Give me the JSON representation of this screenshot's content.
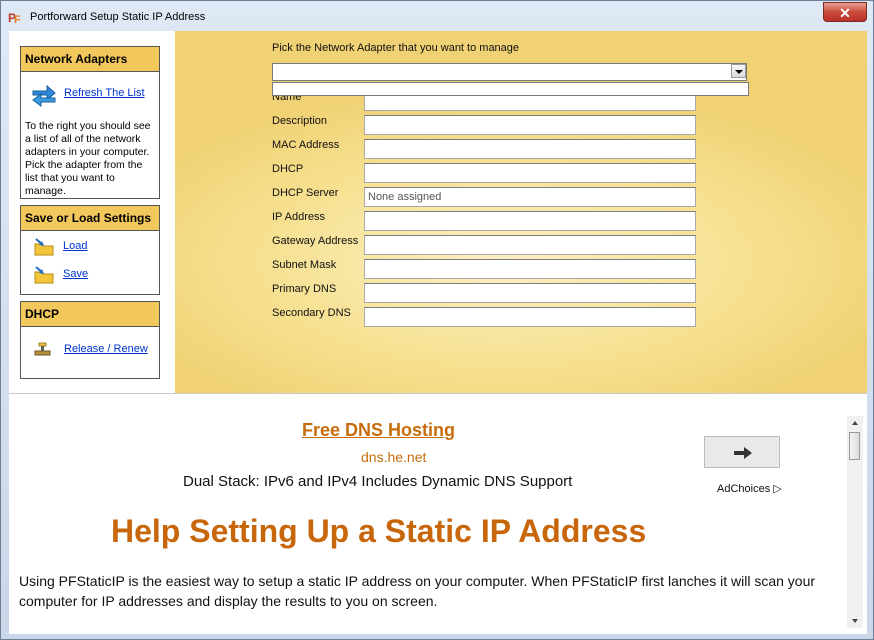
{
  "window": {
    "title": "Portforward Setup Static IP Address",
    "close_label": "✕"
  },
  "sidebar": {
    "network_adapters": {
      "heading": "Network Adapters",
      "refresh_label": "Refresh The List",
      "help_text": "To the right you should see a list of all of the network adapters in your computer. Pick the adapter from the list that you want to manage."
    },
    "save_load": {
      "heading": "Save or Load Settings",
      "load_label": "Load",
      "save_label": "Save"
    },
    "dhcp": {
      "heading": "DHCP",
      "release_label": "Release / Renew"
    }
  },
  "adapter_form": {
    "pick_label": "Pick the Network Adapter that you want to manage",
    "selected_adapter": "",
    "fields": {
      "name": {
        "label": "Name",
        "value": ""
      },
      "description": {
        "label": "Description",
        "value": ""
      },
      "mac": {
        "label": "MAC Address",
        "value": ""
      },
      "dhcp": {
        "label": "DHCP",
        "value": ""
      },
      "dhcp_server": {
        "label": "DHCP Server",
        "value": "None assigned"
      },
      "ip": {
        "label": "IP Address",
        "value": ""
      },
      "gateway": {
        "label": "Gateway Address",
        "value": ""
      },
      "subnet": {
        "label": "Subnet Mask",
        "value": ""
      },
      "primary_dns": {
        "label": "Primary DNS",
        "value": ""
      },
      "secondary_dns": {
        "label": "Secondary DNS",
        "value": ""
      }
    }
  },
  "ad": {
    "title": "Free DNS Hosting",
    "url": "dns.he.net",
    "description": "Dual Stack: IPv6 and IPv4 Includes Dynamic DNS Support",
    "arrow": "➜",
    "adchoices": "AdChoices ▷"
  },
  "help": {
    "heading": "Help Setting Up a Static IP Address",
    "body": "Using PFStaticIP is the easiest way to setup a static IP address on your computer. When PFStaticIP first lanches it will scan your computer for IP addresses and display the results to you on screen."
  },
  "colors": {
    "accent_orange": "#c7660a",
    "panel_header": "#f2c75c",
    "content_background": "#f4dc83",
    "link_blue": "#0033cc"
  }
}
